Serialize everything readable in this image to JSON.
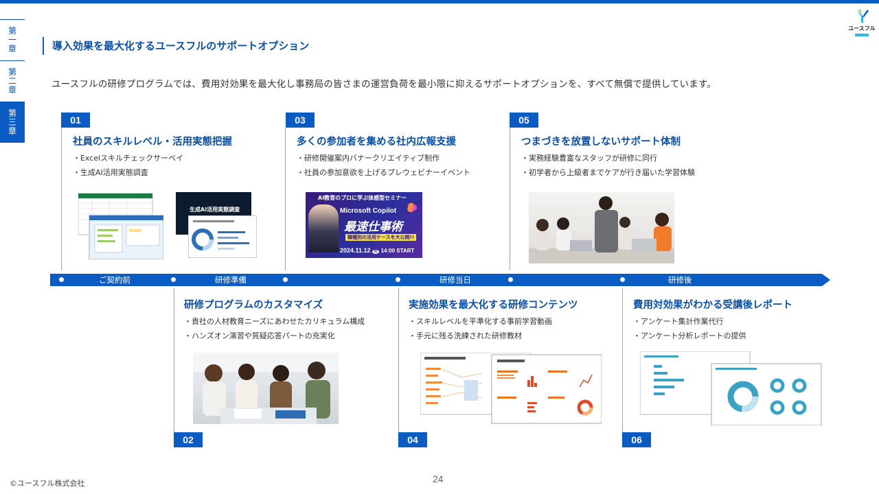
{
  "chapters": [
    {
      "label": [
        "第",
        "一",
        "章"
      ],
      "active": false
    },
    {
      "label": [
        "第",
        "二",
        "章"
      ],
      "active": false
    },
    {
      "label": [
        "第",
        "三",
        "章"
      ],
      "active": true
    }
  ],
  "logo": {
    "text": "ユースフル",
    "icon": "useful-y-logo-icon"
  },
  "page_title": "導入効果を最大化するユースフルのサポートオプション",
  "lead": "ユースフルの研修プログラムでは、費用対効果を最大化し事務局の皆さまの運営負荷を最小限に抑えるサポートオプションを、すべて無償で提供しています。",
  "cards": [
    {
      "num": "01",
      "title": "社員のスキルレベル・活用実態把握",
      "bullets": [
        "・Excelスキルチェックサーベイ",
        "・生成AI活用実態調査"
      ]
    },
    {
      "num": "02",
      "title": "研修プログラムのカスタマイズ",
      "bullets": [
        "・貴社の人材教育ニーズにあわせたカリキュラム構成",
        "・ハンズオン演習や質疑応答パートの充実化"
      ]
    },
    {
      "num": "03",
      "title": "多くの参加者を集める社内広報支援",
      "bullets": [
        "・研修開催案内バナークリエイティブ制作",
        "・社員の参加意欲を上げるプレウェビナーイベント"
      ]
    },
    {
      "num": "04",
      "title": "実施効果を最大化する研修コンテンツ",
      "bullets": [
        "・スキルレベルを平準化する事前学習動画",
        "・手元に残る洗練された研修教材"
      ]
    },
    {
      "num": "05",
      "title": "つまづきを放置しないサポート体制",
      "bullets": [
        "・実務経験豊富なスタッフが研修に同行",
        "・初学者から上級者までケアが行き届いた学習体験"
      ]
    },
    {
      "num": "06",
      "title": "費用対効果がわかる受講後レポート",
      "bullets": [
        "・アンケート集計作業代行",
        "・アンケート分析レポートの提供"
      ]
    }
  ],
  "timeline": [
    "ご契約前",
    "研修準備",
    "研修当日",
    "研修後"
  ],
  "banner": {
    "line1": "AI教育のプロに学ぶ体感型セミナー",
    "line2": "Microsoft Copilot",
    "line3": "最速仕事術",
    "line4": "職種別の活用ケースを大公開!!",
    "date": "2024.11.12",
    "weekday": "火",
    "time": "14:00 START"
  },
  "survey_doc": {
    "title": "生成AI活用実態調査"
  },
  "footer": {
    "copyright": "©ユースフル株式会社",
    "page": "24"
  },
  "colors": {
    "brand": "#0a5bc4",
    "title": "#0a4fa8",
    "accent": "#2eb6e8"
  }
}
